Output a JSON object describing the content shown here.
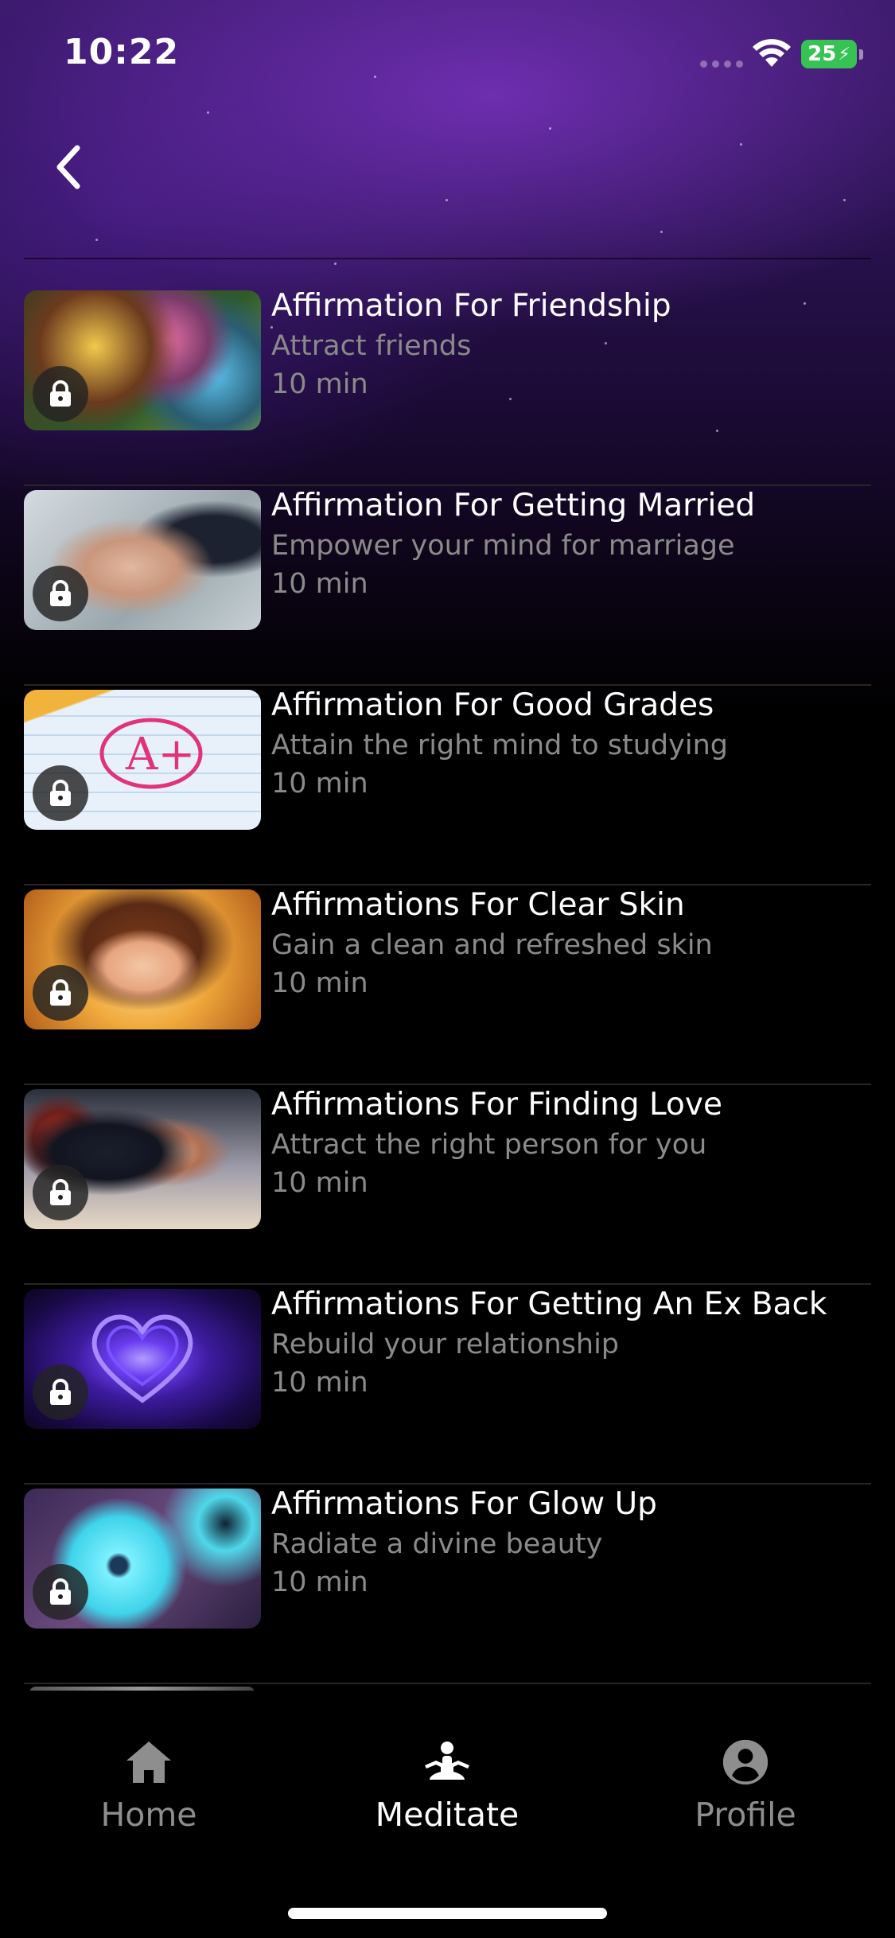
{
  "status_bar": {
    "time": "10:22",
    "battery": "25"
  },
  "colors": {
    "background": "#000000",
    "header_purple": "#3a1a68",
    "secondary_text": "#8a8a8a",
    "battery_green": "#37c254"
  },
  "header": {
    "back_icon": "chevron-left-icon"
  },
  "items": [
    {
      "title": "Affirmation For Friendship",
      "subtitle": "Attract friends",
      "duration": "10 min",
      "locked": true,
      "thumbnail": "friends-photo"
    },
    {
      "title": "Affirmation For Getting Married",
      "subtitle": "Empower your mind for marriage",
      "duration": "10 min",
      "locked": true,
      "thumbnail": "holding-hands-photo"
    },
    {
      "title": "Affirmation For Good Grades",
      "subtitle": "Attain the right mind to studying",
      "duration": "10 min",
      "locked": true,
      "thumbnail": "graded-test-photo"
    },
    {
      "title": "Affirmations For Clear Skin",
      "subtitle": "Gain a clean and refreshed skin",
      "duration": "10 min",
      "locked": true,
      "thumbnail": "glowing-face-illustration"
    },
    {
      "title": "Affirmations For Finding Love",
      "subtitle": "Attract the right person for you",
      "duration": "10 min",
      "locked": true,
      "thumbnail": "couple-illustration"
    },
    {
      "title": "Affirmations For Getting An Ex Back",
      "subtitle": "Rebuild your relationship",
      "duration": "10 min",
      "locked": true,
      "thumbnail": "purple-heart-image"
    },
    {
      "title": "Affirmations For Glow Up",
      "subtitle": "Radiate a divine beauty",
      "duration": "10 min",
      "locked": true,
      "thumbnail": "blue-flowers-image"
    }
  ],
  "tabs": [
    {
      "label": "Home",
      "icon": "home-icon",
      "active": false
    },
    {
      "label": "Meditate",
      "icon": "meditate-icon",
      "active": true
    },
    {
      "label": "Profile",
      "icon": "profile-icon",
      "active": false
    }
  ]
}
